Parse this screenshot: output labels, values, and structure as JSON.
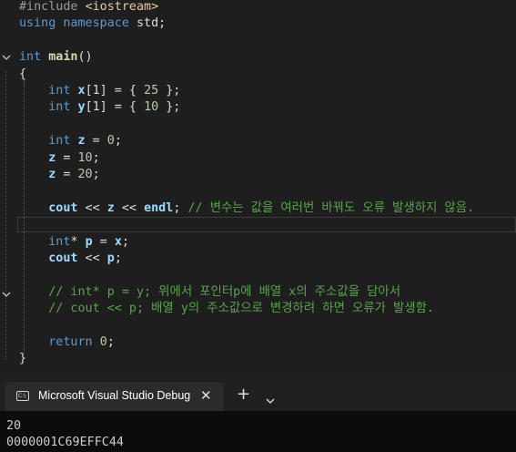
{
  "editor": {
    "lines": [
      {
        "t": [
          {
            "c": "pp",
            "s": "#include "
          },
          {
            "c": "inc",
            "s": "<iostream>"
          }
        ]
      },
      {
        "t": [
          {
            "c": "kw",
            "s": "using namespace "
          },
          {
            "c": "op",
            "s": "std;"
          }
        ]
      },
      {
        "t": []
      },
      {
        "t": [
          {
            "c": "kw",
            "s": "int "
          },
          {
            "c": "fn",
            "s": "main"
          },
          {
            "c": "op",
            "s": "()"
          }
        ]
      },
      {
        "t": [
          {
            "c": "op",
            "s": "{"
          }
        ]
      },
      {
        "t": [
          {
            "c": "kw",
            "s": "    int "
          },
          {
            "c": "var",
            "s": "x"
          },
          {
            "c": "op",
            "s": "[1] = { "
          },
          {
            "c": "num",
            "s": "25"
          },
          {
            "c": "op",
            "s": " };"
          }
        ]
      },
      {
        "t": [
          {
            "c": "kw",
            "s": "    int "
          },
          {
            "c": "var",
            "s": "y"
          },
          {
            "c": "op",
            "s": "[1] = { "
          },
          {
            "c": "num",
            "s": "10"
          },
          {
            "c": "op",
            "s": " };"
          }
        ]
      },
      {
        "t": []
      },
      {
        "t": [
          {
            "c": "kw",
            "s": "    int "
          },
          {
            "c": "var",
            "s": "z"
          },
          {
            "c": "op",
            "s": " = "
          },
          {
            "c": "num",
            "s": "0"
          },
          {
            "c": "op",
            "s": ";"
          }
        ]
      },
      {
        "t": [
          {
            "c": "var",
            "s": "    z"
          },
          {
            "c": "op",
            "s": " = "
          },
          {
            "c": "num",
            "s": "10"
          },
          {
            "c": "op",
            "s": ";"
          }
        ]
      },
      {
        "t": [
          {
            "c": "var",
            "s": "    z"
          },
          {
            "c": "op",
            "s": " = "
          },
          {
            "c": "num",
            "s": "20"
          },
          {
            "c": "op",
            "s": ";"
          }
        ]
      },
      {
        "t": []
      },
      {
        "t": [
          {
            "c": "var",
            "s": "    cout"
          },
          {
            "c": "op",
            "s": " << "
          },
          {
            "c": "var",
            "s": "z"
          },
          {
            "c": "op",
            "s": " << "
          },
          {
            "c": "var",
            "s": "endl"
          },
          {
            "c": "op",
            "s": "; "
          },
          {
            "c": "cm",
            "s": "// 변수는 값을 여러번 바꿔도 오류 발생하지 않음."
          }
        ]
      },
      {
        "t": []
      },
      {
        "t": [
          {
            "c": "kw",
            "s": "    int"
          },
          {
            "c": "op",
            "s": "* "
          },
          {
            "c": "var",
            "s": "p"
          },
          {
            "c": "op",
            "s": " = "
          },
          {
            "c": "var",
            "s": "x"
          },
          {
            "c": "op",
            "s": ";"
          }
        ]
      },
      {
        "t": [
          {
            "c": "var",
            "s": "    cout"
          },
          {
            "c": "op",
            "s": " << "
          },
          {
            "c": "var",
            "s": "p"
          },
          {
            "c": "op",
            "s": ";"
          }
        ]
      },
      {
        "t": []
      },
      {
        "t": [
          {
            "c": "cm",
            "s": "    // int* p = y; 위에서 포인터p에 배열 x의 주소값을 담아서"
          }
        ]
      },
      {
        "t": [
          {
            "c": "cm",
            "s": "    // cout << p; 배열 y의 주소값으로 변경하려 하면 오류가 발생함."
          }
        ]
      },
      {
        "t": []
      },
      {
        "t": [
          {
            "c": "kw",
            "s": "    return "
          },
          {
            "c": "num",
            "s": "0"
          },
          {
            "c": "op",
            "s": ";"
          }
        ]
      },
      {
        "t": [
          {
            "c": "op",
            "s": "}"
          }
        ]
      }
    ]
  },
  "tab": {
    "icon": "terminal-icon",
    "icon_text": "C:\\",
    "title": "Microsoft Visual Studio Debug",
    "close": "✕",
    "add": "+",
    "dropdown": "chevron-down-icon"
  },
  "terminal": {
    "lines": [
      "20",
      "0000001C69EFFC44"
    ]
  },
  "colors": {
    "keyword": "#569cd6",
    "function": "#dcdcaa",
    "number": "#b5cea8",
    "variable": "#9cdcfe",
    "comment": "#57a64a",
    "include": "#e8c9a0"
  }
}
